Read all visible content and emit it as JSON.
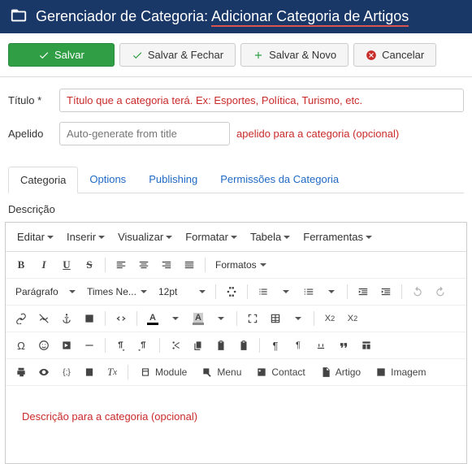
{
  "header": {
    "title_prefix": "Gerenciador de Categoria: ",
    "title_main": "Adicionar Categoria de Artigos"
  },
  "toolbar": {
    "save": "Salvar",
    "save_close": "Salvar & Fechar",
    "save_new": "Salvar & Novo",
    "cancel": "Cancelar"
  },
  "form": {
    "title_label": "Título *",
    "title_value": "Título que a categoria terá. Ex: Esportes, Política, Turismo, etc.",
    "alias_label": "Apelido",
    "alias_placeholder": "Auto-generate from title",
    "alias_annotation": "apelido para a categoria (opcional)"
  },
  "tabs": {
    "category": "Categoria",
    "options": "Options",
    "publishing": "Publishing",
    "permissions": "Permissões da Categoria"
  },
  "desc_label": "Descrição",
  "editor": {
    "menus": {
      "edit": "Editar",
      "insert": "Inserir",
      "view": "Visualizar",
      "format": "Formatar",
      "table": "Tabela",
      "tools": "Ferramentas"
    },
    "formats": "Formatos",
    "paragraph": "Parágrafo",
    "font": "Times Ne...",
    "size": "12pt",
    "insert_buttons": {
      "module": "Module",
      "menu": "Menu",
      "contact": "Contact",
      "article": "Artigo",
      "image": "Imagem"
    }
  },
  "editor_annotation": "Descrição para a categoria (opcional)"
}
